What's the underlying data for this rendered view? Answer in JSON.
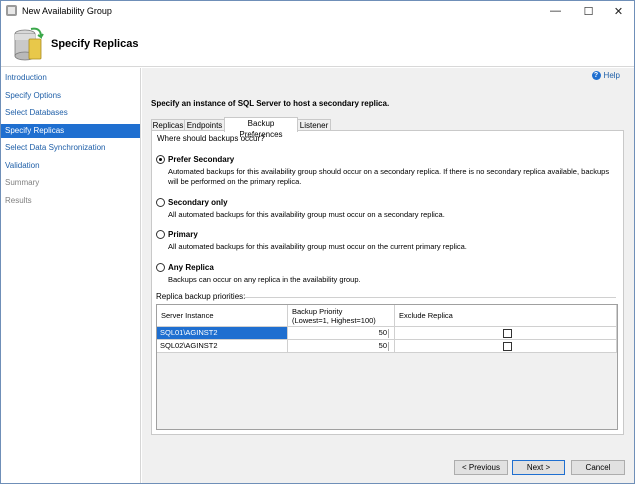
{
  "window": {
    "title": "New Availability Group",
    "controls": [
      "—",
      "☐",
      "✕"
    ]
  },
  "header": {
    "title": "Specify Replicas"
  },
  "nav": {
    "items": [
      {
        "label": "Introduction",
        "state": "link"
      },
      {
        "label": "Specify Options",
        "state": "link"
      },
      {
        "label": "Select Databases",
        "state": "link"
      },
      {
        "label": "Specify Replicas",
        "state": "selected"
      },
      {
        "label": "Select Data Synchronization",
        "state": "link"
      },
      {
        "label": "Validation",
        "state": "link"
      },
      {
        "label": "Summary",
        "state": "disabled"
      },
      {
        "label": "Results",
        "state": "disabled"
      }
    ]
  },
  "help": {
    "label": "Help",
    "icon": "help-icon"
  },
  "instruction": "Specify an instance of SQL Server to host a secondary replica.",
  "tabs": [
    {
      "label": "Replicas"
    },
    {
      "label": "Endpoints"
    },
    {
      "label": "Backup Preferences",
      "active": true
    },
    {
      "label": "Listener"
    }
  ],
  "backup": {
    "question": "Where should backups occur?",
    "options": [
      {
        "label": "Prefer Secondary",
        "checked": true,
        "description": "Automated backups for this availability group should occur on a secondary replica. If there is no secondary replica available, backups will be performed on the primary replica."
      },
      {
        "label": "Secondary only",
        "checked": false,
        "description": "All automated backups for this availability group must occur on a secondary replica."
      },
      {
        "label": "Primary",
        "checked": false,
        "description": "All automated backups for this availability group must occur on the current primary replica."
      },
      {
        "label": "Any Replica",
        "checked": false,
        "description": "Backups can occur on any replica in the availability group."
      }
    ]
  },
  "priorities": {
    "label": "Replica backup priorities:",
    "columns": {
      "server": "Server Instance",
      "priority_line1": "Backup Priority",
      "priority_line2": "(Lowest=1, Highest=100)",
      "exclude": "Exclude Replica"
    },
    "rows": [
      {
        "server": "SQL01\\AGINST2",
        "priority": "50",
        "exclude": false,
        "selected": true
      },
      {
        "server": "SQL02\\AGINST2",
        "priority": "50",
        "exclude": false,
        "selected": false
      }
    ]
  },
  "footer": {
    "previous": "< Previous",
    "next": "Next >",
    "cancel": "Cancel"
  },
  "colors": {
    "accent": "#1f6fd0",
    "link": "#1f5fa8"
  }
}
